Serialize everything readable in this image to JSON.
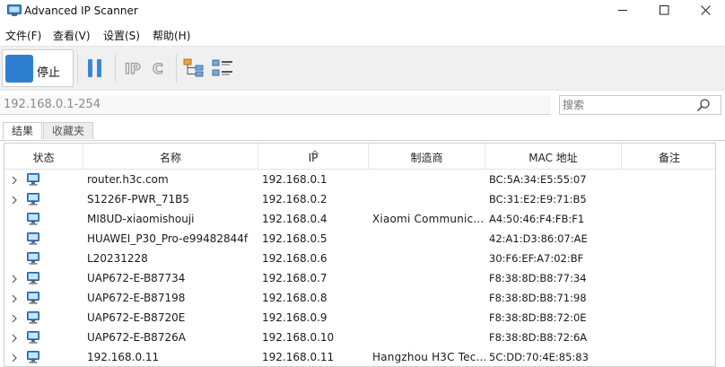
{
  "window": {
    "title": "Advanced IP Scanner"
  },
  "menu": [
    {
      "label": "文件(F)"
    },
    {
      "label": "查看(V)"
    },
    {
      "label": "设置(S)"
    },
    {
      "label": "帮助(H)"
    }
  ],
  "toolbar": {
    "stop_label": "停止",
    "accent_color": "#2f7fd0",
    "icons": [
      "pause-icon",
      "ip-icon",
      "c-icon",
      "network-tree-icon",
      "list-details-icon"
    ]
  },
  "address": {
    "value": "192.168.0.1-254"
  },
  "search": {
    "placeholder": "搜索"
  },
  "tabs": [
    {
      "label": "结果",
      "active": true
    },
    {
      "label": "收藏夹",
      "active": false
    }
  ],
  "table": {
    "columns": [
      "状态",
      "名称",
      "IP",
      "制造商",
      "MAC 地址",
      "备注"
    ],
    "sort_column": "IP",
    "rows": [
      {
        "expandable": true,
        "name": "router.h3c.com",
        "ip": "192.168.0.1",
        "manufacturer": "",
        "mac": "BC:5A:34:E5:55:07",
        "notes": ""
      },
      {
        "expandable": true,
        "name": "S1226F-PWR_71B5",
        "ip": "192.168.0.2",
        "manufacturer": "",
        "mac": "BC:31:E2:E9:71:B5",
        "notes": ""
      },
      {
        "expandable": false,
        "name": "MI8UD-xiaomishouji",
        "ip": "192.168.0.4",
        "manufacturer": "Xiaomi Communic...",
        "mac": "A4:50:46:F4:FB:F1",
        "notes": ""
      },
      {
        "expandable": false,
        "name": "HUAWEI_P30_Pro-e99482844f",
        "ip": "192.168.0.5",
        "manufacturer": "",
        "mac": "42:A1:D3:86:07:AE",
        "notes": ""
      },
      {
        "expandable": false,
        "name": "L20231228",
        "ip": "192.168.0.6",
        "manufacturer": "",
        "mac": "30:F6:EF:A7:02:BF",
        "notes": ""
      },
      {
        "expandable": true,
        "name": "UAP672-E-B87734",
        "ip": "192.168.0.7",
        "manufacturer": "",
        "mac": "F8:38:8D:B8:77:34",
        "notes": ""
      },
      {
        "expandable": true,
        "name": "UAP672-E-B87198",
        "ip": "192.168.0.8",
        "manufacturer": "",
        "mac": "F8:38:8D:B8:71:98",
        "notes": ""
      },
      {
        "expandable": true,
        "name": "UAP672-E-B8720E",
        "ip": "192.168.0.9",
        "manufacturer": "",
        "mac": "F8:38:8D:B8:72:0E",
        "notes": ""
      },
      {
        "expandable": true,
        "name": "UAP672-E-B8726A",
        "ip": "192.168.0.10",
        "manufacturer": "",
        "mac": "F8:38:8D:B8:72:6A",
        "notes": ""
      },
      {
        "expandable": true,
        "name": "192.168.0.11",
        "ip": "192.168.0.11",
        "manufacturer": "Hangzhou H3C Tec...",
        "mac": "5C:DD:70:4E:85:83",
        "notes": ""
      }
    ]
  }
}
